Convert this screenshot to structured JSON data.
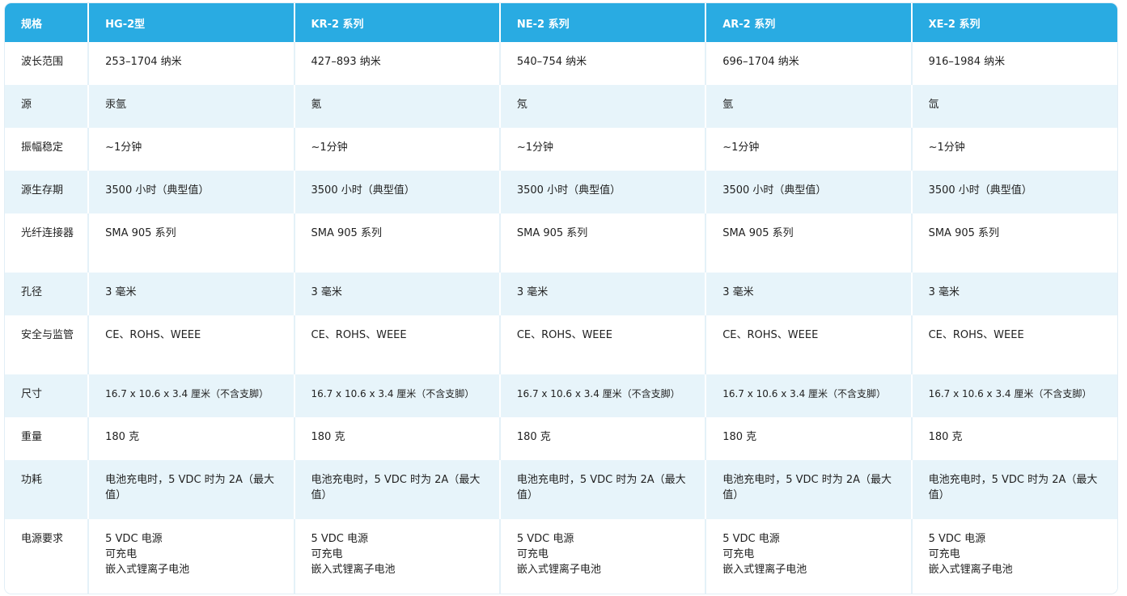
{
  "table": {
    "headers": [
      "规格",
      "HG-2型",
      "KR-2 系列",
      "NE-2 系列",
      "AR-2 系列",
      "XE-2 系列"
    ],
    "rows": [
      {
        "label": "波长范围",
        "cells": [
          "253–1704 纳米",
          "427–893 纳米",
          "540–754 纳米",
          "696–1704 纳米",
          "916–1984 纳米"
        ]
      },
      {
        "label": "源",
        "cells": [
          "汞氩",
          "氪",
          "氖",
          "氩",
          "氙"
        ]
      },
      {
        "label": "振幅稳定",
        "cells": [
          "~1分钟",
          "~1分钟",
          "~1分钟",
          "~1分钟",
          "~1分钟"
        ]
      },
      {
        "label": "源生存期",
        "cells": [
          "3500 小时（典型值）",
          "3500 小时（典型值）",
          "3500 小时（典型值）",
          "3500 小时（典型值）",
          "3500 小时（典型值）"
        ]
      },
      {
        "label": "光纤连接器",
        "cells": [
          "SMA 905 系列",
          "SMA 905 系列",
          "SMA 905 系列",
          "SMA 905 系列",
          "SMA 905 系列"
        ]
      },
      {
        "label": "孔径",
        "cells": [
          "3 毫米",
          "3 毫米",
          "3 毫米",
          "3 毫米",
          "3 毫米"
        ]
      },
      {
        "label": "安全与监管",
        "cells": [
          "CE、ROHS、WEEE",
          "CE、ROHS、WEEE",
          "CE、ROHS、WEEE",
          "CE、ROHS、WEEE",
          "CE、ROHS、WEEE"
        ]
      },
      {
        "label": "尺寸",
        "cells": [
          "16.7 x 10.6 x 3.4 厘米（不含支脚）",
          "16.7 x 10.6 x 3.4 厘米（不含支脚）",
          "16.7 x 10.6 x 3.4 厘米（不含支脚）",
          "16.7 x 10.6 x 3.4 厘米（不含支脚）",
          "16.7 x 10.6 x 3.4 厘米（不含支脚）"
        ]
      },
      {
        "label": "重量",
        "cells": [
          "180 克",
          "180 克",
          "180 克",
          "180 克",
          "180 克"
        ]
      },
      {
        "label": "功耗",
        "cells": [
          "电池充电时，5 VDC 时为 2A（最大值）",
          "电池充电时，5 VDC 时为 2A（最大值）",
          "电池充电时，5 VDC 时为 2A（最大值）",
          "电池充电时，5 VDC 时为 2A（最大值）",
          "电池充电时，5 VDC 时为 2A（最大值）"
        ]
      }
    ],
    "power_row": {
      "label": "电源要求",
      "lines": [
        "5 VDC 电源",
        "可充电",
        "嵌入式锂离子电池"
      ]
    }
  },
  "colors": {
    "header_bg": "#29abe2",
    "header_text": "#ffffff",
    "stripe_bg": "#e7f4fa",
    "text": "#222222"
  }
}
